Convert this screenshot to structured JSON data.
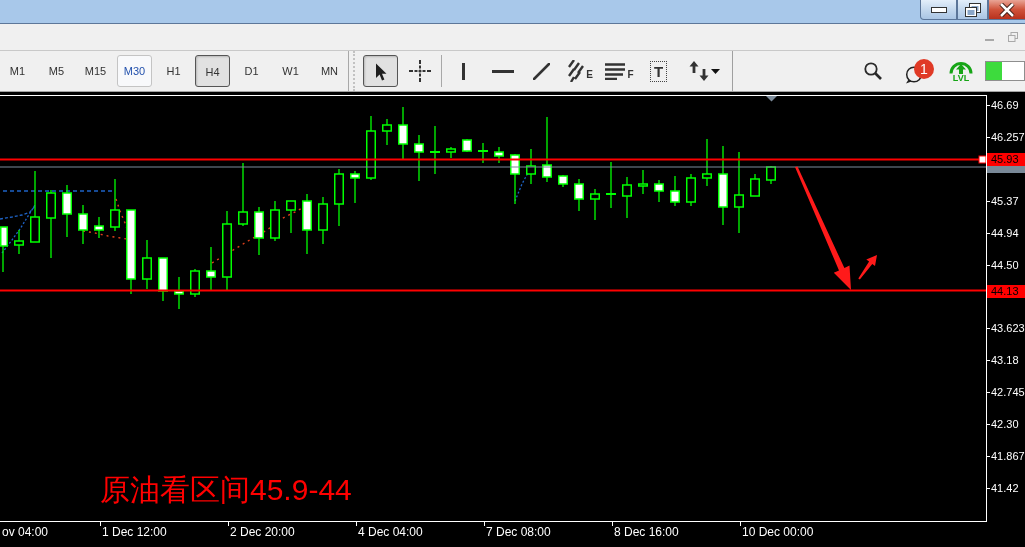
{
  "timeframes": [
    {
      "label": "M1",
      "selected": false,
      "hovered": false
    },
    {
      "label": "M5",
      "selected": false,
      "hovered": false
    },
    {
      "label": "M15",
      "selected": false,
      "hovered": false
    },
    {
      "label": "M30",
      "selected": false,
      "hovered": true
    },
    {
      "label": "H1",
      "selected": false,
      "hovered": false
    },
    {
      "label": "H4",
      "selected": true,
      "hovered": false
    },
    {
      "label": "D1",
      "selected": false,
      "hovered": false
    },
    {
      "label": "W1",
      "selected": false,
      "hovered": false
    },
    {
      "label": "MN",
      "selected": false,
      "hovered": false
    }
  ],
  "tool_groups": [
    {
      "tools": [
        {
          "kind": "cursor",
          "selected": true
        },
        {
          "kind": "crosshair",
          "selected": false
        }
      ]
    },
    {
      "tools": [
        {
          "kind": "vertical-line",
          "selected": false
        },
        {
          "kind": "horizontal-line",
          "selected": false
        },
        {
          "kind": "trend-line",
          "selected": false
        },
        {
          "kind": "channel",
          "label": "E",
          "selected": false
        },
        {
          "kind": "fibonacci",
          "label": "F",
          "selected": false
        },
        {
          "kind": "text",
          "label": "T",
          "selected": false
        },
        {
          "kind": "arrows",
          "selected": false
        }
      ]
    }
  ],
  "status_tools": {
    "notifications": {
      "badge": "1"
    },
    "lvl_button": {
      "label": "LVL"
    }
  },
  "chart": {
    "price_labels": [
      "46.69",
      "46.257",
      "45.37",
      "44.94",
      "44.50",
      "43.623",
      "43.18",
      "42.745",
      "42.30",
      "41.867",
      "41.42"
    ],
    "price_tags": [
      "45.93",
      "44.13"
    ],
    "time_labels": [
      "ov 04:00",
      "1 Dec 12:00",
      "2 Dec 20:00",
      "4 Dec 04:00",
      "7 Dec 08:00",
      "8 Dec 16:00",
      "10 Dec 00:00"
    ],
    "annotation": "原油看区间45.9-44"
  }
}
